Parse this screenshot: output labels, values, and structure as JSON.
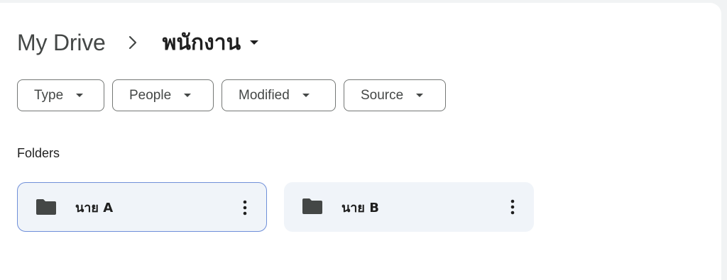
{
  "breadcrumb": {
    "root": "My Drive",
    "separator_icon": "chevron-right-icon",
    "current": "พนักงาน",
    "current_caret_icon": "caret-down-icon"
  },
  "filters": [
    {
      "label": "Type",
      "icon": "caret-down-icon"
    },
    {
      "label": "People",
      "icon": "caret-down-icon"
    },
    {
      "label": "Modified",
      "icon": "caret-down-icon"
    },
    {
      "label": "Source",
      "icon": "caret-down-icon"
    }
  ],
  "folders_section": {
    "title": "Folders",
    "items": [
      {
        "name": "นาย A",
        "icon": "folder-icon",
        "menu_icon": "more-vert-icon",
        "selected": true
      },
      {
        "name": "นาย B",
        "icon": "folder-icon",
        "menu_icon": "more-vert-icon",
        "selected": false
      }
    ]
  },
  "colors": {
    "background": "#f1f3f4",
    "panel": "#ffffff",
    "chip_border": "#747775",
    "folder_card": "#f0f4f9",
    "selected_border": "#6f8fd9",
    "icon": "#444746"
  }
}
